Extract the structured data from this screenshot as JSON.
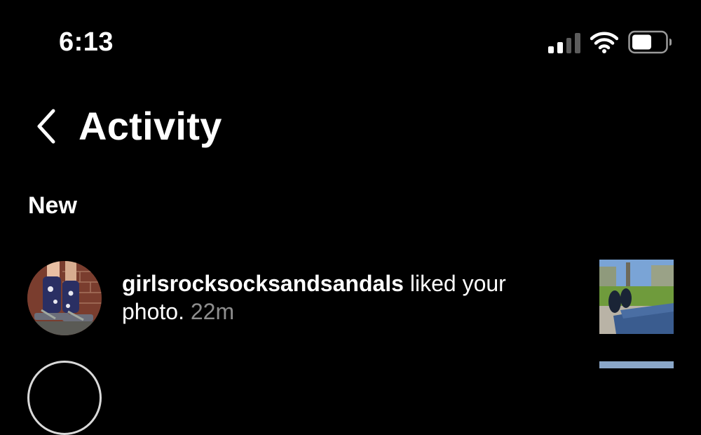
{
  "status_bar": {
    "time": "6:13",
    "icons": [
      "cellular-signal-icon",
      "wifi-icon",
      "battery-icon"
    ],
    "signal_bars_active": 2,
    "signal_bars_total": 4,
    "battery_level": 0.5
  },
  "header": {
    "back_icon": "chevron-left-icon",
    "title": "Activity"
  },
  "sections": [
    {
      "heading": "New",
      "items": [
        {
          "username": "girlsrocksocksandsandals",
          "action": " liked your photo.",
          "time": " 22m",
          "avatar": "avatar-photo-socks",
          "thumbnail": "post-thumbnail-photo"
        }
      ]
    }
  ],
  "colors": {
    "background": "#000000",
    "text_primary": "#ffffff",
    "text_secondary": "#8e8e8e"
  }
}
